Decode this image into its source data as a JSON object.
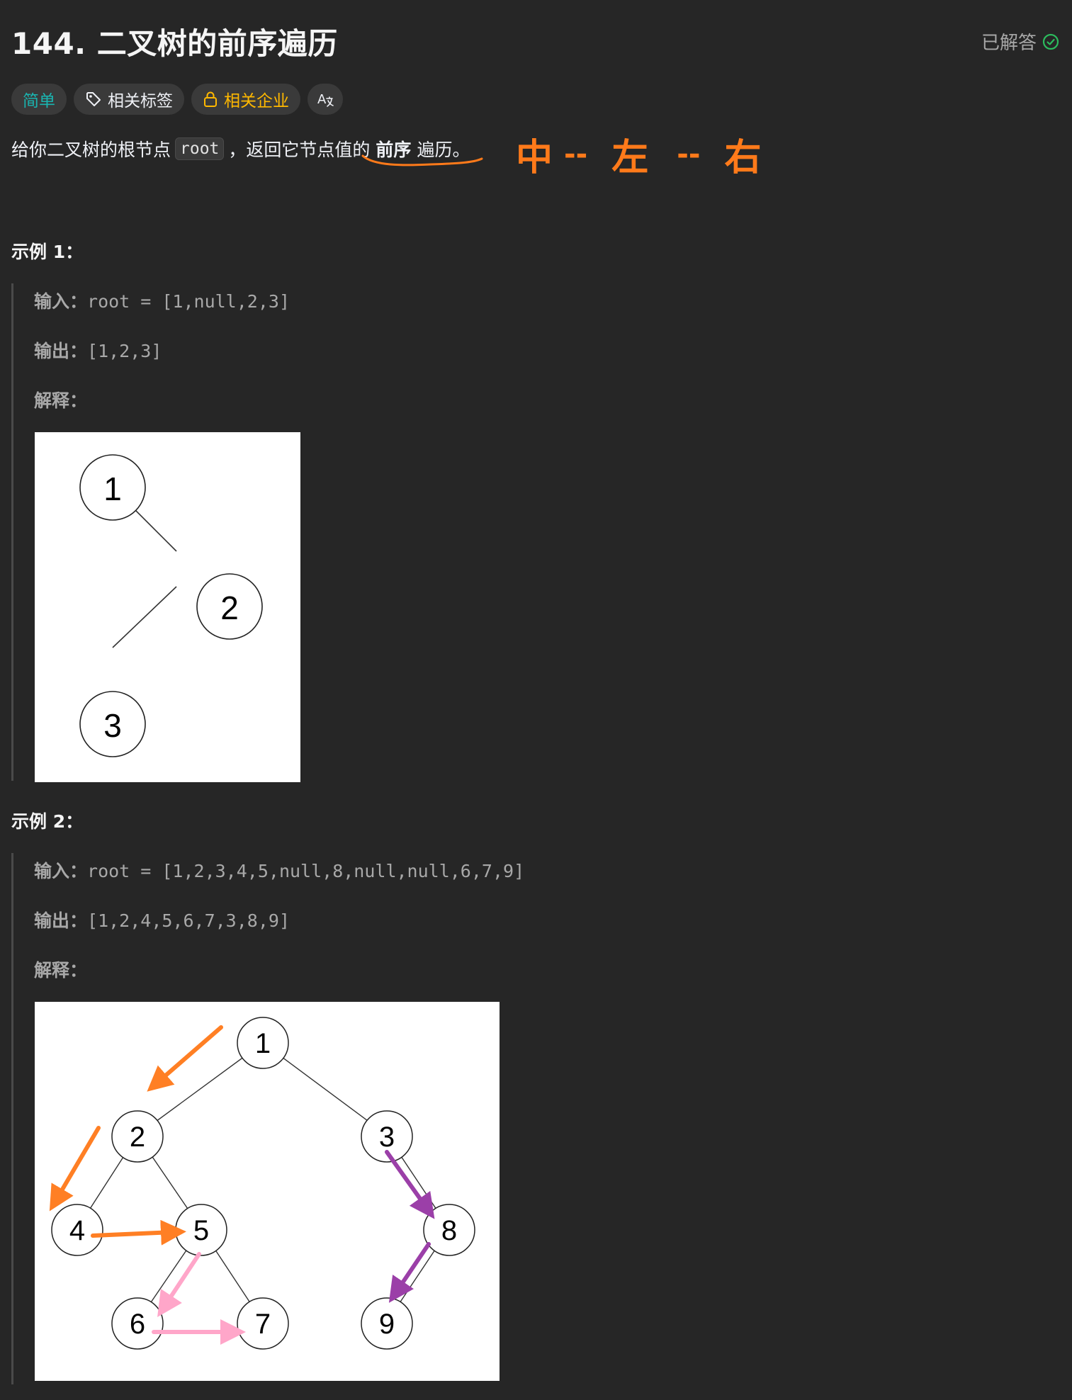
{
  "problem": {
    "title": "144. 二叉树的前序遍历",
    "status": "已解答",
    "tags": [
      {
        "label": "简单",
        "icon": "none"
      },
      {
        "label": "相关标签",
        "icon": "tag-icon"
      },
      {
        "label": "相关企业",
        "icon": "lock-icon"
      },
      {
        "label": "",
        "icon": "translate-icon"
      }
    ],
    "translate_icon_text": "A",
    "description": {
      "before": "给你二叉树的根节点",
      "code": "root",
      "middle": "，返回它节点值的",
      "bold": "前序",
      "after": "遍历。"
    }
  },
  "annotation": {
    "order": [
      "中",
      "--",
      "左",
      "--",
      "右"
    ],
    "accent_color": "#ff7a1a"
  },
  "examples": [
    {
      "heading": "示例 1：",
      "input_label": "输入：",
      "input_value": "root = [1,null,2,3]",
      "output_label": "输出：",
      "output_value": "[1,2,3]",
      "explain_label": "解释：",
      "tree": {
        "nodes": [
          "1",
          "2",
          "3"
        ]
      }
    },
    {
      "heading": "示例 2：",
      "input_label": "输入：",
      "input_value": "root = [1,2,3,4,5,null,8,null,null,6,7,9]",
      "output_label": "输出：",
      "output_value": "[1,2,4,5,6,7,3,8,9]",
      "explain_label": "解释：",
      "tree": {
        "nodes": [
          "1",
          "2",
          "3",
          "4",
          "5",
          "8",
          "6",
          "7",
          "9"
        ]
      },
      "arrow_colors": {
        "orange": "#ff7f24",
        "pink": "#ffa6c9",
        "purple": "#9b3fa8"
      }
    }
  ]
}
